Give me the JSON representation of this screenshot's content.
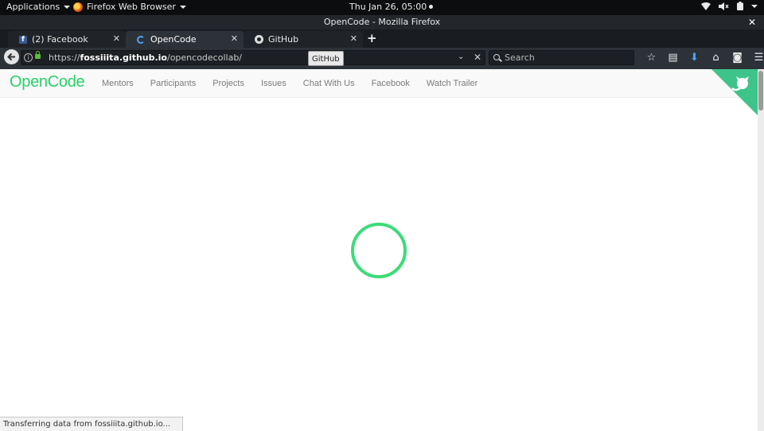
{
  "topbar": {
    "applications": "Applications",
    "browser_menu": "Firefox Web Browser",
    "clock": "Thu Jan 26, 05:00"
  },
  "window": {
    "title": "OpenCode - Mozilla Firefox"
  },
  "tabs": [
    {
      "label": "(2) Facebook",
      "icon": "facebook-icon",
      "active": false
    },
    {
      "label": "OpenCode",
      "icon": "loading-spinner-icon",
      "active": true
    },
    {
      "label": "GitHub",
      "icon": "github-icon",
      "active": false
    }
  ],
  "navbar": {
    "url_prefix": "https://",
    "url_domain": "fossiiita.github.io",
    "url_path": "/opencodecollab/",
    "tooltip": "GitHub",
    "search_placeholder": "Search"
  },
  "site": {
    "logo": "OpenCode",
    "nav_links": [
      "Mentors",
      "Participants",
      "Projects",
      "Issues",
      "Chat With Us",
      "Facebook",
      "Watch Trailer"
    ],
    "accent_color": "#27d169"
  },
  "status": {
    "text": "Transferring data from fossiiita.github.io..."
  }
}
